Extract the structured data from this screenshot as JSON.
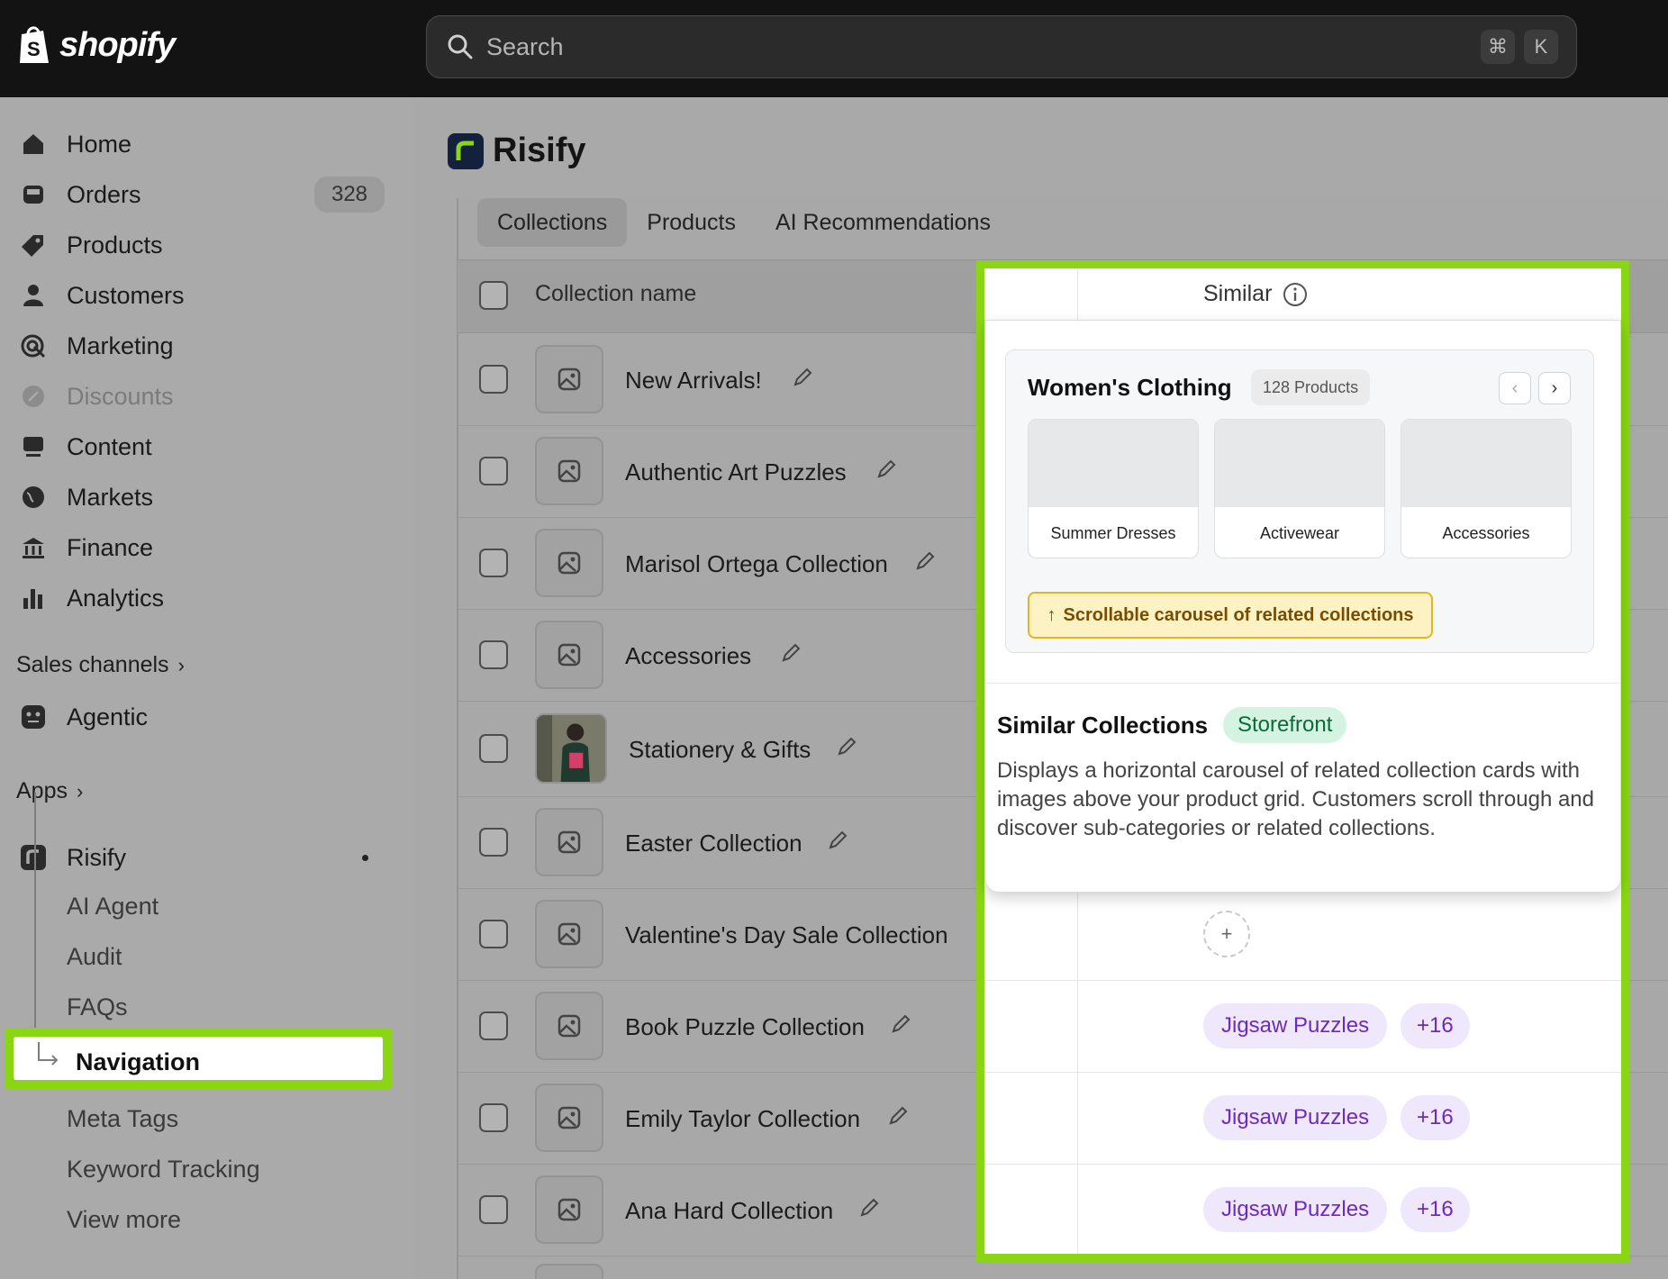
{
  "topbar": {
    "brand": "shopify",
    "search_placeholder": "Search",
    "kbd_cmd": "⌘",
    "kbd_k": "K"
  },
  "sidebar": {
    "items": [
      {
        "label": "Home",
        "icon": "home-icon"
      },
      {
        "label": "Orders",
        "icon": "orders-icon",
        "badge": "328"
      },
      {
        "label": "Products",
        "icon": "tag-icon"
      },
      {
        "label": "Customers",
        "icon": "person-icon"
      },
      {
        "label": "Marketing",
        "icon": "target-icon"
      },
      {
        "label": "Discounts",
        "icon": "discount-icon",
        "disabled": true
      },
      {
        "label": "Content",
        "icon": "content-icon"
      },
      {
        "label": "Markets",
        "icon": "globe-icon"
      },
      {
        "label": "Finance",
        "icon": "bank-icon"
      },
      {
        "label": "Analytics",
        "icon": "bar-chart-icon"
      }
    ],
    "sales_channels": "Sales channels",
    "agentic": "Agentic",
    "apps": "Apps",
    "app_name": "Risify",
    "app_sub_items": [
      "AI Agent",
      "Audit",
      "FAQs",
      "Navigation",
      "Meta Tags",
      "Keyword Tracking",
      "View more"
    ],
    "selected": "Navigation"
  },
  "main": {
    "title": "Risify",
    "tabs": [
      "Collections",
      "Products",
      "AI Recommendations"
    ],
    "active_tab": "Collections",
    "column_header": "Collection name",
    "rows": [
      "New Arrivals!",
      "Authentic Art Puzzles",
      "Marisol Ortega Collection",
      "Accessories",
      "Stationery & Gifts",
      "Easter Collection",
      "Valentine's Day Sale Collection",
      "Book Puzzle Collection",
      "Emily Taylor Collection",
      "Ana Hard Collection"
    ]
  },
  "panel": {
    "column_header": "Similar",
    "preview": {
      "title": "Women's Clothing",
      "count": "128 Products",
      "cards": [
        "Summer Dresses",
        "Activewear",
        "Accessories"
      ],
      "note": "Scrollable carousel of related collections"
    },
    "feature_title": "Similar Collections",
    "feature_badge": "Storefront",
    "description": "Displays a horizontal carousel of related collection cards with images above your product grid. Customers scroll through and discover sub-categories or related collections.",
    "add_symbol": "+",
    "tag_label": "Jigsaw Puzzles",
    "tag_more": "+16"
  },
  "colors": {
    "highlight": "#8bd614",
    "tag_bg": "#efe7fb",
    "tag_text": "#6c2bb9",
    "storefront_bg": "#d4f4e1",
    "note_bg": "#fdf2c4"
  }
}
